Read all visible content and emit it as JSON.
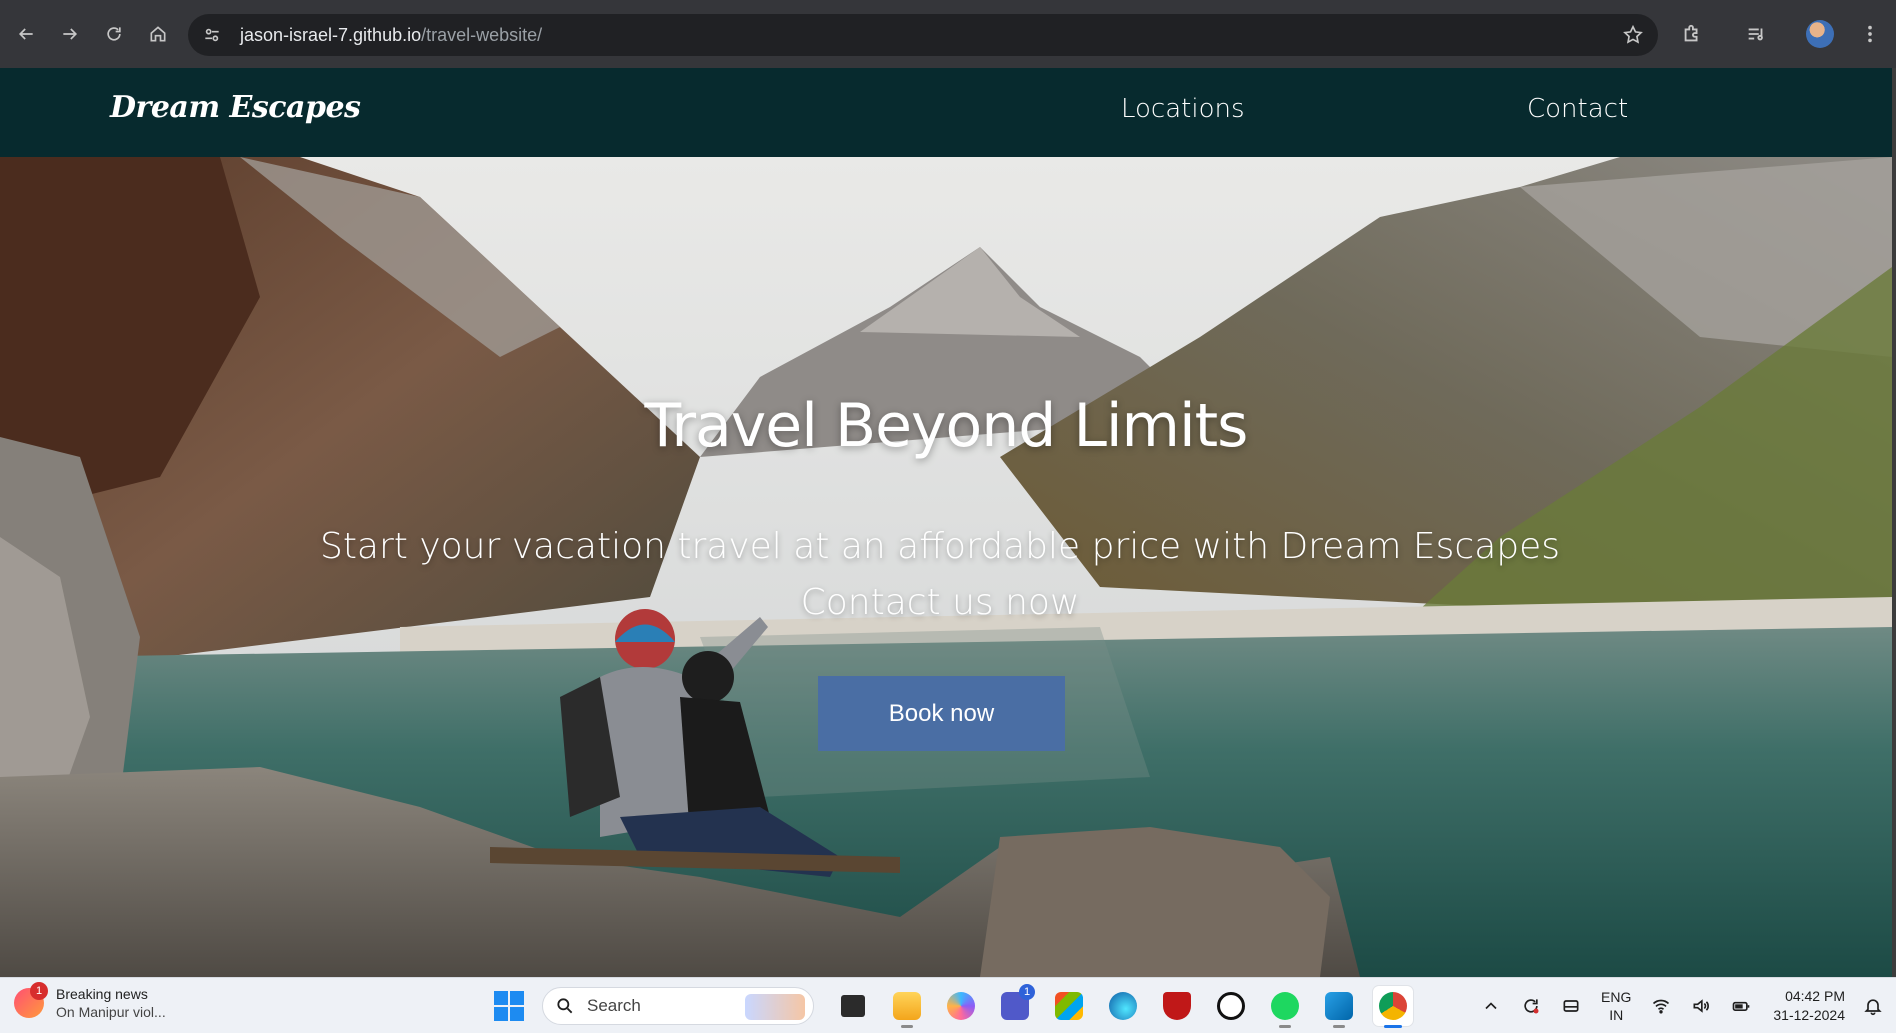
{
  "browser": {
    "url_host": "jason-israel-7.github.io",
    "url_path": "/travel-website/",
    "icons": [
      "back-icon",
      "forward-icon",
      "reload-icon",
      "home-icon",
      "site-settings-icon",
      "bookmark-star-icon",
      "extensions-icon",
      "media-controls-icon",
      "profile-avatar",
      "more-menu-icon"
    ]
  },
  "site": {
    "brand": "Dream Escapes",
    "nav": [
      {
        "label": "Locations"
      },
      {
        "label": "Contact"
      }
    ],
    "hero": {
      "title": "Travel Beyond Limits",
      "subtitle": "Start your vacation travel at an affordable price with Dream Escapes Contact us now",
      "cta": "Book now"
    },
    "colors": {
      "header_bg": "#072a2e",
      "button_bg": "#4a6ea4",
      "text": "#ffffff"
    }
  },
  "taskbar": {
    "news": {
      "badge": "1",
      "title": "Breaking news",
      "subtitle": "On Manipur viol..."
    },
    "search_placeholder": "Search",
    "apps": [
      {
        "name": "file-manager-icon"
      },
      {
        "name": "file-explorer-icon"
      },
      {
        "name": "copilot-icon"
      },
      {
        "name": "teams-icon",
        "badge": "1"
      },
      {
        "name": "microsoft-store-icon"
      },
      {
        "name": "edge-icon"
      },
      {
        "name": "mcafee-icon"
      },
      {
        "name": "dell-icon"
      },
      {
        "name": "spotify-icon"
      },
      {
        "name": "vscode-icon"
      },
      {
        "name": "chrome-icon"
      }
    ],
    "language": {
      "line1": "ENG",
      "line2": "IN"
    },
    "clock": {
      "time": "04:42 PM",
      "date": "31-12-2024"
    }
  }
}
